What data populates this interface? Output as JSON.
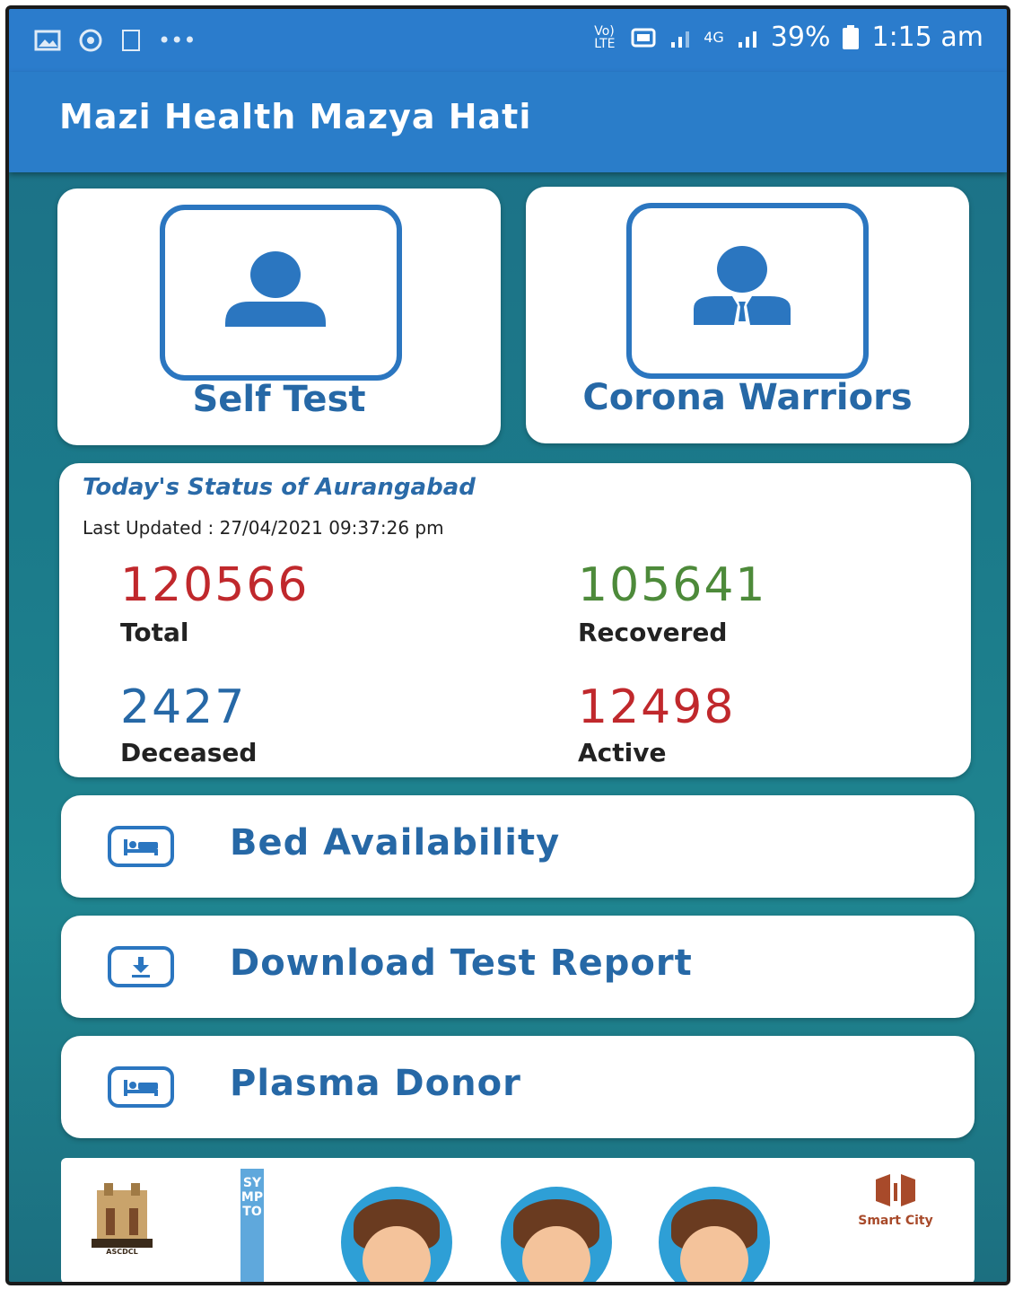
{
  "statusbar": {
    "network_label": "Vo) LTE",
    "signal_label": "4G",
    "battery": "39%",
    "time": "1:15 am"
  },
  "appbar": {
    "title": "Mazi Health Mazya Hati"
  },
  "tiles": [
    {
      "label": "Self Test",
      "icon": "person-icon"
    },
    {
      "label": "Corona Warriors",
      "icon": "suit-person-icon"
    }
  ],
  "status": {
    "title": "Today's Status of Aurangabad",
    "last_updated": "Last Updated : 27/04/2021 09:37:26 pm",
    "stats": [
      {
        "value": "120566",
        "label": "Total",
        "color": "#c0282c"
      },
      {
        "value": "105641",
        "label": "Recovered",
        "color": "#4d8a3a"
      },
      {
        "value": "2427",
        "label": "Deceased",
        "color": "#2668a6"
      },
      {
        "value": "12498",
        "label": "Active",
        "color": "#c0282c"
      }
    ]
  },
  "menu": [
    {
      "label": "Bed Availability",
      "icon": "bed-icon"
    },
    {
      "label": "Download Test Report",
      "icon": "download-icon"
    },
    {
      "label": "Plasma Donor",
      "icon": "bed-icon"
    }
  ],
  "banner": {
    "symptoms_text": "SYMPTO",
    "smart_city_label": "Smart City",
    "ascdcl_label": "ASCDCL"
  },
  "colors": {
    "primary": "#2a7dc9",
    "accent_blue": "#2668a6",
    "red": "#c0282c",
    "green": "#4d8a3a"
  }
}
